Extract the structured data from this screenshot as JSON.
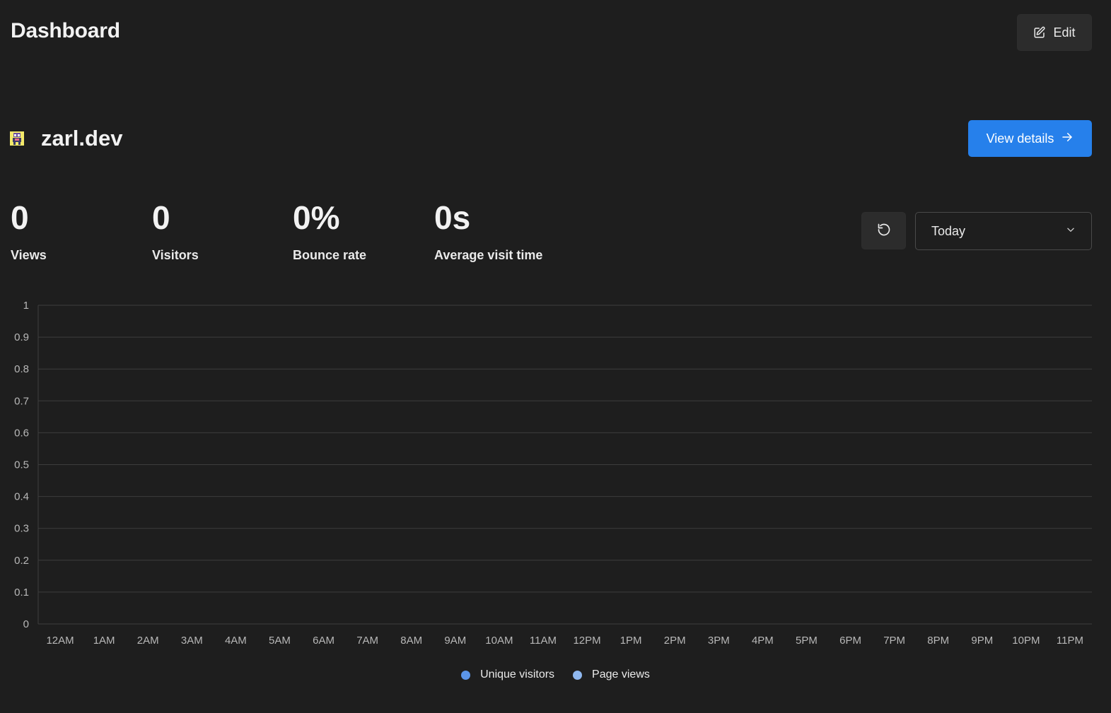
{
  "header": {
    "title": "Dashboard",
    "edit_label": "Edit"
  },
  "website": {
    "name": "zarl.dev",
    "view_details_label": "View details",
    "icon": "site-favicon"
  },
  "metrics": [
    {
      "value": "0",
      "label": "Views"
    },
    {
      "value": "0",
      "label": "Visitors"
    },
    {
      "value": "0%",
      "label": "Bounce rate"
    },
    {
      "value": "0s",
      "label": "Average visit time"
    }
  ],
  "controls": {
    "refresh_icon": "refresh-icon",
    "date_range_value": "Today"
  },
  "colors": {
    "accent": "#2680eb",
    "unique_visitors": "#5b95e8",
    "page_views": "#8fb8f0",
    "grid": "#3d3d3d"
  },
  "chart_data": {
    "type": "bar",
    "categories": [
      "12AM",
      "1AM",
      "2AM",
      "3AM",
      "4AM",
      "5AM",
      "6AM",
      "7AM",
      "8AM",
      "9AM",
      "10AM",
      "11AM",
      "12PM",
      "1PM",
      "2PM",
      "3PM",
      "4PM",
      "5PM",
      "6PM",
      "7PM",
      "8PM",
      "9PM",
      "10PM",
      "11PM"
    ],
    "series": [
      {
        "name": "Unique visitors",
        "values": [
          0,
          0,
          0,
          0,
          0,
          0,
          0,
          0,
          0,
          0,
          0,
          0,
          0,
          0,
          0,
          0,
          0,
          0,
          0,
          0,
          0,
          0,
          0,
          0
        ]
      },
      {
        "name": "Page views",
        "values": [
          0,
          0,
          0,
          0,
          0,
          0,
          0,
          0,
          0,
          0,
          0,
          0,
          0,
          0,
          0,
          0,
          0,
          0,
          0,
          0,
          0,
          0,
          0,
          0
        ]
      }
    ],
    "yticks": [
      "0",
      "0.1",
      "0.2",
      "0.3",
      "0.4",
      "0.5",
      "0.6",
      "0.7",
      "0.8",
      "0.9",
      "1"
    ],
    "ylim": [
      0,
      1
    ],
    "grid": true,
    "legend_placement": "bottom-center"
  }
}
